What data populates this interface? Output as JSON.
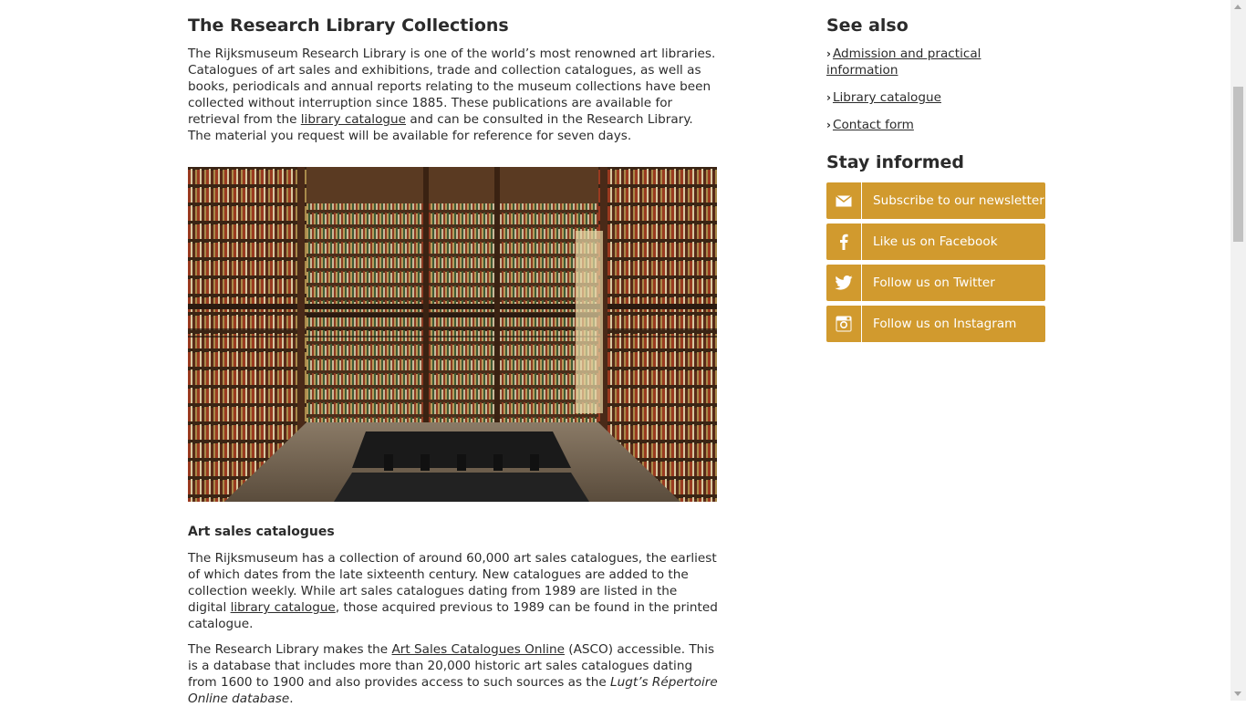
{
  "main": {
    "title": "The Research Library Collections",
    "intro": {
      "text1": "The Rijksmuseum Research Library is one of the world’s most renowned art libraries. Catalogues of art sales and exhibitions, trade and collection catalogues, as well as books, periodicals and annual reports relating to the museum collections have been collected without interruption since 1885. These publications are available for retrieval from the ",
      "link": "library catalogue",
      "text2": " and can be consulted in the Research Library. The material you request will be available for reference for seven days."
    },
    "photo_alt": "Research Library reading room",
    "art_sales": {
      "heading": "Art sales catalogues",
      "p1_text1": "The Rijksmuseum has a collection of around 60,000 art sales catalogues, the earliest of which dates from the late sixteenth century. New catalogues are added to the collection weekly. While art sales catalogues dating from 1989 are listed in the digital ",
      "p1_link": "library catalogue",
      "p1_text2": ", those acquired previous to 1989 can be found in the printed catalogue.",
      "p2_text1": "The Research Library makes the ",
      "p2_link": "Art Sales Catalogues Online",
      "p2_text2": " (ASCO) accessible. This is a database that includes more than 20,000 historic art sales catalogues dating from 1600 to 1900 and also provides access to such sources as the ",
      "p2_italic": "Lugt’s Répertoire Online database",
      "p2_text3": "."
    }
  },
  "sidebar": {
    "see_also_title": "See also",
    "see_also": [
      {
        "label": "Admission and practical information"
      },
      {
        "label": "Library catalogue"
      },
      {
        "label": "Contact form"
      }
    ],
    "stay_title": "Stay informed",
    "social": [
      {
        "label": "Subscribe to our newsletter",
        "icon": "envelope-icon"
      },
      {
        "label": "Like us on Facebook",
        "icon": "facebook-icon"
      },
      {
        "label": "Follow us on Twitter",
        "icon": "twitter-icon"
      },
      {
        "label": "Follow us on Instagram",
        "icon": "instagram-icon"
      }
    ]
  },
  "colors": {
    "accent": "#d19a2e",
    "text": "#2b2b2b",
    "background": "#ffffff"
  }
}
